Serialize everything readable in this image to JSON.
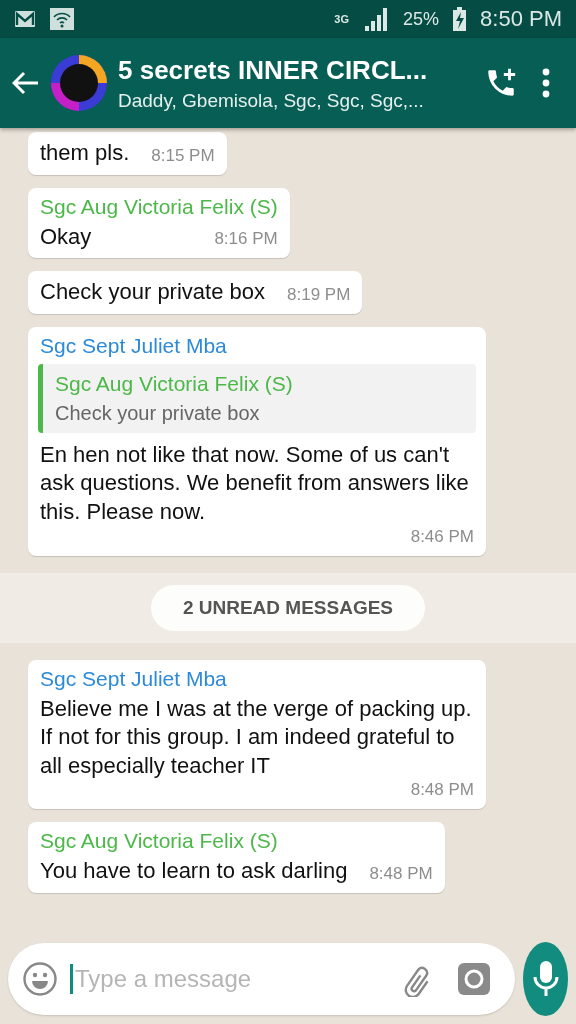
{
  "status_bar": {
    "network": "3G",
    "battery": "25%",
    "time": "8:50 PM"
  },
  "header": {
    "title": "5 secrets INNER CIRCL...",
    "subtitle": "Daddy, Gbemisola, Sgc, Sgc, Sgc,..."
  },
  "messages": [
    {
      "kind": "text",
      "text": "them pls.",
      "time": "8:15 PM"
    },
    {
      "kind": "text",
      "sender": "Sgc Aug Victoria Felix (S)",
      "color": "#4cb849",
      "text": "Okay",
      "time": "8:16 PM"
    },
    {
      "kind": "text",
      "text": "Check your private box",
      "time": "8:19 PM"
    },
    {
      "kind": "text",
      "sender": "Sgc Sept Juliet Mba",
      "color": "#2d8ad8",
      "quote": {
        "sender": "Sgc Aug Victoria Felix (S)",
        "color": "#4cb849",
        "text": "Check your private box"
      },
      "text": "En hen not like that now. Some of us can't ask questions. We benefit from answers like this. Please now.",
      "time": "8:46 PM"
    },
    {
      "kind": "divider",
      "text": "2 UNREAD MESSAGES"
    },
    {
      "kind": "text",
      "sender": "Sgc Sept Juliet Mba",
      "color": "#2d8ad8",
      "text": "Believe me I was at the verge of packing up. If not for this group. I am indeed grateful to all especially teacher IT",
      "time": "8:48 PM"
    },
    {
      "kind": "text",
      "sender": "Sgc Aug Victoria Felix (S)",
      "color": "#4cb849",
      "text": "You have to learn to ask darling",
      "time": "8:48 PM"
    }
  ],
  "composer": {
    "placeholder": "Type a message"
  }
}
